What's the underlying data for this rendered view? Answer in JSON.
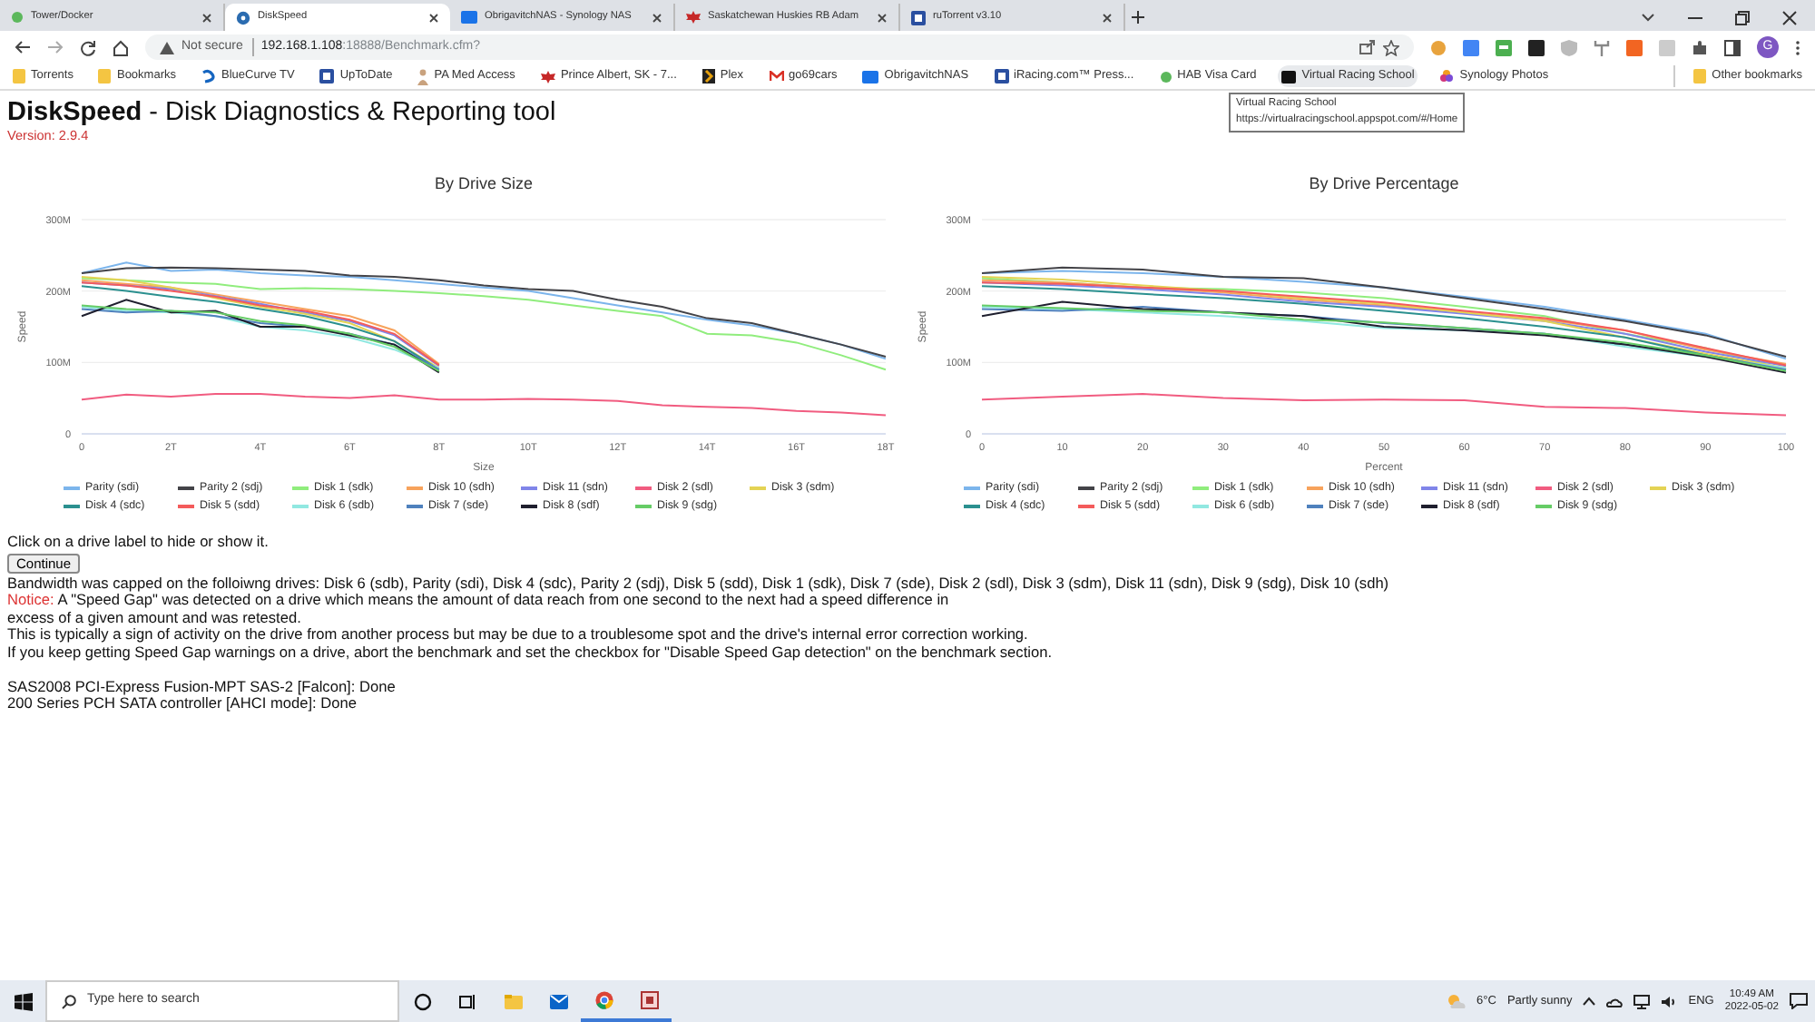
{
  "browser": {
    "tabs": [
      {
        "title": "Tower/Docker",
        "kind": "dot",
        "selected": false
      },
      {
        "title": "DiskSpeed",
        "kind": "disk",
        "selected": true
      },
      {
        "title": "ObrigavitchNAS - Synology NAS",
        "kind": "dsm",
        "selected": false
      },
      {
        "title": "Saskatchewan Huskies RB Adam",
        "kind": "leaf",
        "selected": false
      },
      {
        "title": "ruTorrent v3.10",
        "kind": "square",
        "selected": false
      }
    ],
    "address": {
      "security": "Not secure",
      "host": "192.168.1.108",
      "rest": ":18888/Benchmark.cfm?"
    },
    "profile_initial": "G",
    "bookmarks": [
      {
        "label": "Torrents",
        "kind": "folder",
        "hovered": false
      },
      {
        "label": "Bookmarks",
        "kind": "folder",
        "hovered": false
      },
      {
        "label": "BlueCurve TV",
        "kind": "wave",
        "hovered": false
      },
      {
        "label": "UpToDate",
        "kind": "square",
        "hovered": false
      },
      {
        "label": "PA Med Access",
        "kind": "person",
        "hovered": false
      },
      {
        "label": "Prince Albert, SK - 7...",
        "kind": "leaf",
        "hovered": false
      },
      {
        "label": "Plex",
        "kind": "chevron",
        "hovered": false
      },
      {
        "label": "go69cars",
        "kind": "mail",
        "hovered": false
      },
      {
        "label": "ObrigavitchNAS",
        "kind": "dsm",
        "hovered": false
      },
      {
        "label": "iRacing.com™ Press...",
        "kind": "square",
        "hovered": false
      },
      {
        "label": "HAB Visa Card",
        "kind": "dot",
        "hovered": false
      },
      {
        "label": "Virtual Racing School",
        "kind": "dark",
        "hovered": true
      },
      {
        "label": "Synology Photos",
        "kind": "flower",
        "hovered": false
      }
    ],
    "other_bookmarks": "Other bookmarks",
    "tooltip": {
      "title": "Virtual Racing School",
      "url": "https://virtualracingschool.appspot.com/#/Home"
    }
  },
  "page": {
    "title": "DiskSpeed",
    "subtitle": "- Disk Diagnostics & Reporting tool",
    "version": "Version: 2.9.4",
    "charts": [
      {
        "chart_data": {
          "type": "line",
          "legend": "bottom",
          "title": "By Drive Size",
          "xlabel": "Size",
          "ylabel": "Speed",
          "x": [
            0,
            1,
            2,
            3,
            4,
            5,
            6,
            7,
            8,
            9,
            10,
            11,
            12,
            13,
            14,
            15,
            16,
            17,
            18
          ],
          "xlim": [
            0,
            18
          ],
          "ylim": [
            0,
            300
          ],
          "xticks": [
            {
              "value": 0,
              "label": "0"
            },
            {
              "value": 2,
              "label": "2T"
            },
            {
              "value": 4,
              "label": "4T"
            },
            {
              "value": 6,
              "label": "6T"
            },
            {
              "value": 8,
              "label": "8T"
            },
            {
              "value": 10,
              "label": "10T"
            },
            {
              "value": 12,
              "label": "12T"
            },
            {
              "value": 14,
              "label": "14T"
            },
            {
              "value": 16,
              "label": "16T"
            },
            {
              "value": 18,
              "label": "18T"
            }
          ],
          "yticks": [
            {
              "value": 0,
              "label": "0"
            },
            {
              "value": 100,
              "label": "100M"
            },
            {
              "value": 200,
              "label": "200M"
            },
            {
              "value": 300,
              "label": "300M"
            }
          ],
          "series": [
            {
              "name": "Parity (sdi)",
              "color": "#7cb5ec",
              "values": [
                225,
                240,
                228,
                230,
                225,
                222,
                220,
                215,
                210,
                205,
                200,
                190,
                180,
                170,
                160,
                152,
                140,
                125,
                105
              ]
            },
            {
              "name": "Parity 2 (sdj)",
              "color": "#434348",
              "values": [
                225,
                232,
                233,
                232,
                230,
                228,
                222,
                220,
                215,
                208,
                203,
                200,
                188,
                178,
                162,
                155,
                140,
                125,
                108
              ]
            },
            {
              "name": "Disk 1 (sdk)",
              "color": "#90ed7d",
              "values": [
                218,
                215,
                212,
                210,
                203,
                204,
                203,
                200,
                197,
                193,
                188,
                180,
                172,
                165,
                140,
                138,
                128,
                110,
                90
              ]
            },
            {
              "name": "Disk 10 (sdh)",
              "color": "#f7a35c",
              "values": [
                215,
                210,
                205,
                195,
                185,
                175,
                165,
                145,
                98,
                null,
                null,
                null,
                null,
                null,
                null,
                null,
                null,
                null,
                null
              ]
            },
            {
              "name": "Disk 11 (sdn)",
              "color": "#8085e9",
              "values": [
                212,
                208,
                203,
                193,
                182,
                170,
                158,
                138,
                95,
                null,
                null,
                null,
                null,
                null,
                null,
                null,
                null,
                null,
                null
              ]
            },
            {
              "name": "Disk 2 (sdl)",
              "color": "#f15c80",
              "values": [
                48,
                55,
                52,
                56,
                56,
                52,
                50,
                54,
                48,
                48,
                49,
                48,
                46,
                40,
                38,
                36,
                32,
                30,
                26
              ]
            },
            {
              "name": "Disk 3 (sdm)",
              "color": "#e4d354",
              "values": [
                220,
                215,
                205,
                190,
                178,
                168,
                155,
                130,
                92,
                null,
                null,
                null,
                null,
                null,
                null,
                null,
                null,
                null,
                null
              ]
            },
            {
              "name": "Disk 4 (sdc)",
              "color": "#2b908f",
              "values": [
                207,
                200,
                192,
                185,
                175,
                165,
                150,
                130,
                90,
                null,
                null,
                null,
                null,
                null,
                null,
                null,
                null,
                null,
                null
              ]
            },
            {
              "name": "Disk 5 (sdd)",
              "color": "#f45b5b",
              "values": [
                212,
                208,
                200,
                192,
                180,
                172,
                160,
                140,
                96,
                null,
                null,
                null,
                null,
                null,
                null,
                null,
                null,
                null,
                null
              ]
            },
            {
              "name": "Disk 6 (sdb)",
              "color": "#91e8e1",
              "values": [
                178,
                172,
                170,
                165,
                150,
                145,
                135,
                118,
                92,
                null,
                null,
                null,
                null,
                null,
                null,
                null,
                null,
                null,
                null
              ]
            },
            {
              "name": "Disk 7 (sde)",
              "color": "#4f81bd",
              "values": [
                175,
                170,
                172,
                165,
                155,
                150,
                140,
                125,
                90,
                null,
                null,
                null,
                null,
                null,
                null,
                null,
                null,
                null,
                null
              ]
            },
            {
              "name": "Disk 8 (sdf)",
              "color": "#1f1f2e",
              "values": [
                165,
                188,
                170,
                172,
                150,
                150,
                138,
                125,
                86,
                null,
                null,
                null,
                null,
                null,
                null,
                null,
                null,
                null,
                null
              ]
            },
            {
              "name": "Disk 9 (sdg)",
              "color": "#66cc66",
              "values": [
                180,
                175,
                172,
                170,
                158,
                152,
                140,
                122,
                88,
                null,
                null,
                null,
                null,
                null,
                null,
                null,
                null,
                null,
                null
              ]
            }
          ]
        }
      },
      {
        "chart_data": {
          "type": "line",
          "legend": "bottom",
          "title": "By Drive Percentage",
          "xlabel": "Percent",
          "ylabel": "Speed",
          "x": [
            0,
            10,
            20,
            30,
            40,
            50,
            60,
            70,
            80,
            90,
            100
          ],
          "xlim": [
            0,
            100
          ],
          "ylim": [
            0,
            300
          ],
          "xticks": [
            0,
            10,
            20,
            30,
            40,
            50,
            60,
            70,
            80,
            90,
            100
          ],
          "yticks": [
            {
              "value": 0,
              "label": "0"
            },
            {
              "value": 100,
              "label": "100M"
            },
            {
              "value": 200,
              "label": "200M"
            },
            {
              "value": 300,
              "label": "300M"
            }
          ],
          "series": [
            {
              "name": "Parity (sdi)",
              "color": "#7cb5ec",
              "values": [
                225,
                228,
                225,
                220,
                213,
                205,
                192,
                178,
                160,
                140,
                105
              ]
            },
            {
              "name": "Parity 2 (sdj)",
              "color": "#434348",
              "values": [
                225,
                233,
                230,
                220,
                218,
                205,
                190,
                175,
                158,
                138,
                108
              ]
            },
            {
              "name": "Disk 1 (sdk)",
              "color": "#90ed7d",
              "values": [
                218,
                212,
                205,
                203,
                198,
                190,
                178,
                165,
                140,
                120,
                90
              ]
            },
            {
              "name": "Disk 10 (sdh)",
              "color": "#f7a35c",
              "values": [
                215,
                212,
                205,
                198,
                188,
                180,
                170,
                160,
                145,
                118,
                98
              ]
            },
            {
              "name": "Disk 11 (sdn)",
              "color": "#8085e9",
              "values": [
                212,
                208,
                203,
                195,
                185,
                178,
                168,
                158,
                140,
                115,
                95
              ]
            },
            {
              "name": "Disk 2 (sdl)",
              "color": "#f15c80",
              "values": [
                48,
                52,
                56,
                50,
                47,
                48,
                47,
                38,
                36,
                30,
                26
              ]
            },
            {
              "name": "Disk 3 (sdm)",
              "color": "#e4d354",
              "values": [
                220,
                216,
                208,
                200,
                190,
                182,
                170,
                158,
                135,
                112,
                92
              ]
            },
            {
              "name": "Disk 4 (sdc)",
              "color": "#2b908f",
              "values": [
                207,
                203,
                196,
                190,
                182,
                172,
                162,
                150,
                135,
                110,
                90
              ]
            },
            {
              "name": "Disk 5 (sdd)",
              "color": "#f45b5b",
              "values": [
                212,
                210,
                205,
                200,
                192,
                184,
                172,
                162,
                145,
                120,
                96
              ]
            },
            {
              "name": "Disk 6 (sdb)",
              "color": "#91e8e1",
              "values": [
                178,
                175,
                170,
                165,
                158,
                148,
                145,
                140,
                122,
                108,
                92
              ]
            },
            {
              "name": "Disk 7 (sde)",
              "color": "#4f81bd",
              "values": [
                175,
                172,
                178,
                170,
                165,
                155,
                148,
                140,
                125,
                110,
                90
              ]
            },
            {
              "name": "Disk 8 (sdf)",
              "color": "#1f1f2e",
              "values": [
                165,
                185,
                175,
                170,
                165,
                150,
                145,
                138,
                125,
                108,
                86
              ]
            },
            {
              "name": "Disk 9 (sdg)",
              "color": "#66cc66",
              "values": [
                180,
                176,
                172,
                170,
                160,
                156,
                148,
                140,
                128,
                110,
                88
              ]
            }
          ]
        }
      }
    ],
    "hint": "Click on a drive label to hide or show it.",
    "continue_button": "Continue",
    "bandwidth_note": "Bandwidth was capped on the folloiwng drives: Disk 6 (sdb), Parity (sdi), Disk 4 (sdc), Parity 2 (sdj), Disk 5 (sdd), Disk 1 (sdk), Disk 7 (sde), Disk 2 (sdl), Disk 3 (sdm), Disk 11 (sdn), Disk 9 (sdg), Disk 10 (sdh)",
    "notice": {
      "label": "Notice:",
      "lines": [
        "A \"Speed Gap\" was detected on a drive which means the amount of data reach from one second to the next had a speed difference in",
        "excess of a given amount and was retested."
      ]
    },
    "paragraphs": [
      "This is typically a sign of activity on the drive from another process but may be due to a troublesome spot and the drive's internal error correction working.",
      "If you keep getting Speed Gap warnings on a drive, abort the benchmark and set the checkbox for \"Disable Speed Gap detection\" on the benchmark section."
    ],
    "controllers": [
      "SAS2008 PCI-Express Fusion-MPT SAS-2 [Falcon]: Done",
      "200 Series PCH SATA controller [AHCI mode]: Done"
    ]
  },
  "taskbar": {
    "search_placeholder": "Type here to search",
    "weather": {
      "temperature": "6°C",
      "condition": "Partly sunny"
    },
    "language": "ENG",
    "time": "10:49 AM",
    "date": "2022-05-02"
  }
}
